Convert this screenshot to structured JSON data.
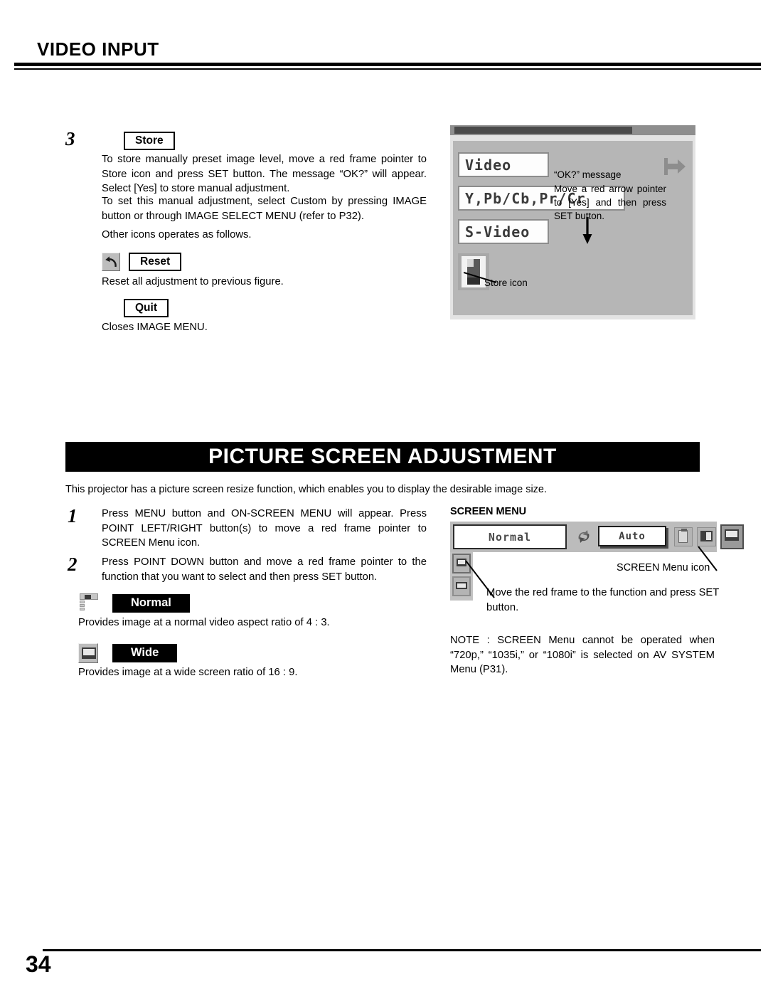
{
  "header": {
    "title": "VIDEO INPUT"
  },
  "store_section": {
    "step_number": "3",
    "store_label": "Store",
    "paragraph1": "To store manually preset image level, move a red frame pointer to Store icon and press SET button.  The message “OK?” will appear.  Select [Yes] to store manual adjustment.",
    "paragraph2": "To set this manual adjustment, select Custom by pressing IMAGE button or through IMAGE SELECT MENU (refer to P32).",
    "other_icons_note": "Other icons operates as follows.",
    "reset_label": "Reset",
    "reset_desc": "Reset all adjustment to previous figure.",
    "quit_label": "Quit",
    "quit_desc": "Closes IMAGE MENU."
  },
  "osd_capture": {
    "items": [
      "Video",
      "Y,Pb/Cb,Pr/Cr",
      "S-Video"
    ],
    "ok_message_label": "“OK?” message",
    "ok_message_body": "Move a red arrow pointer to [Yes] and then press SET button.",
    "store_icon_label": "Store icon"
  },
  "picture_screen": {
    "banner_title": "PICTURE SCREEN ADJUSTMENT",
    "intro": "This projector has a picture screen resize function, which enables you to display the desirable image size.",
    "step1_number": "1",
    "step1_text": "Press MENU button and ON-SCREEN MENU will appear.  Press POINT LEFT/RIGHT button(s) to move a red frame pointer to SCREEN Menu icon.",
    "step2_number": "2",
    "step2_text": "Press POINT DOWN button and move a red frame pointer to the function that you want to select and then press SET button.",
    "normal_label": "Normal",
    "normal_desc": "Provides image at a normal video aspect ratio of 4 : 3.",
    "wide_label": "Wide",
    "wide_desc": "Provides image at a wide screen ratio of 16 : 9."
  },
  "screen_menu": {
    "heading": "SCREEN MENU",
    "bar_value": "Normal",
    "bar_auto": "Auto",
    "menu_icon_label": "SCREEN Menu icon",
    "frame_hint": "Move the red frame to the function and press SET button.",
    "note": "NOTE : SCREEN Menu cannot be operated when “720p,” “1035i,” or “1080i” is selected on AV SYSTEM Menu (P31)."
  },
  "footer": {
    "page_number": "34"
  },
  "colors": {
    "ink": "#000000",
    "paper": "#ffffff",
    "osd_gray": "#b6b6b6",
    "tile_gray": "#bdbdbd"
  }
}
